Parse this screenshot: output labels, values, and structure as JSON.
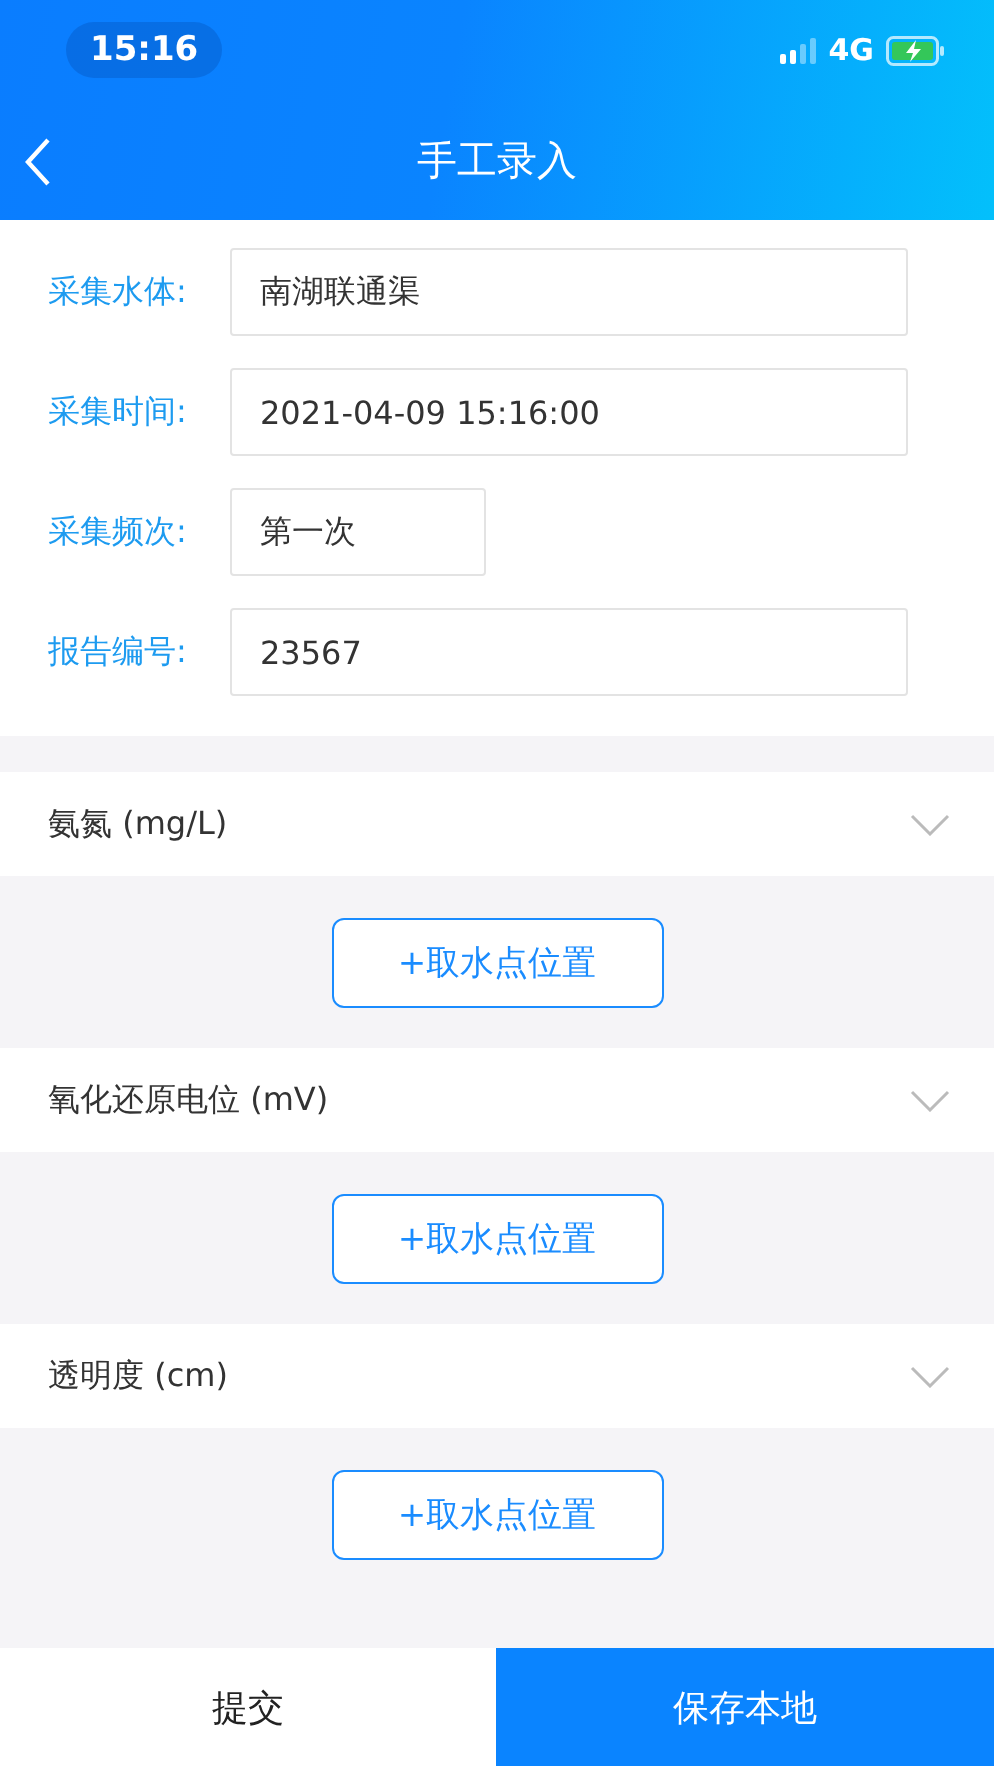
{
  "status_bar": {
    "time": "15:16",
    "network": "4G"
  },
  "nav": {
    "title": "手工录入"
  },
  "form": [
    {
      "label": "采集水体:",
      "value": "南湖联通渠",
      "kind": "wide"
    },
    {
      "label": "采集时间:",
      "value": "2021-04-09 15:16:00",
      "kind": "wide"
    },
    {
      "label": "采集频次:",
      "value": "第一次",
      "kind": "short"
    },
    {
      "label": "报告编号:",
      "value": "23567",
      "kind": "wide"
    }
  ],
  "sections": [
    {
      "title": "氨氮 (mg/L)",
      "button": "+取水点位置"
    },
    {
      "title": "氧化还原电位 (mV)",
      "button": "+取水点位置"
    },
    {
      "title": "透明度 (cm)",
      "button": "+取水点位置"
    }
  ],
  "footer": {
    "submit": "提交",
    "save": "保存本地"
  }
}
